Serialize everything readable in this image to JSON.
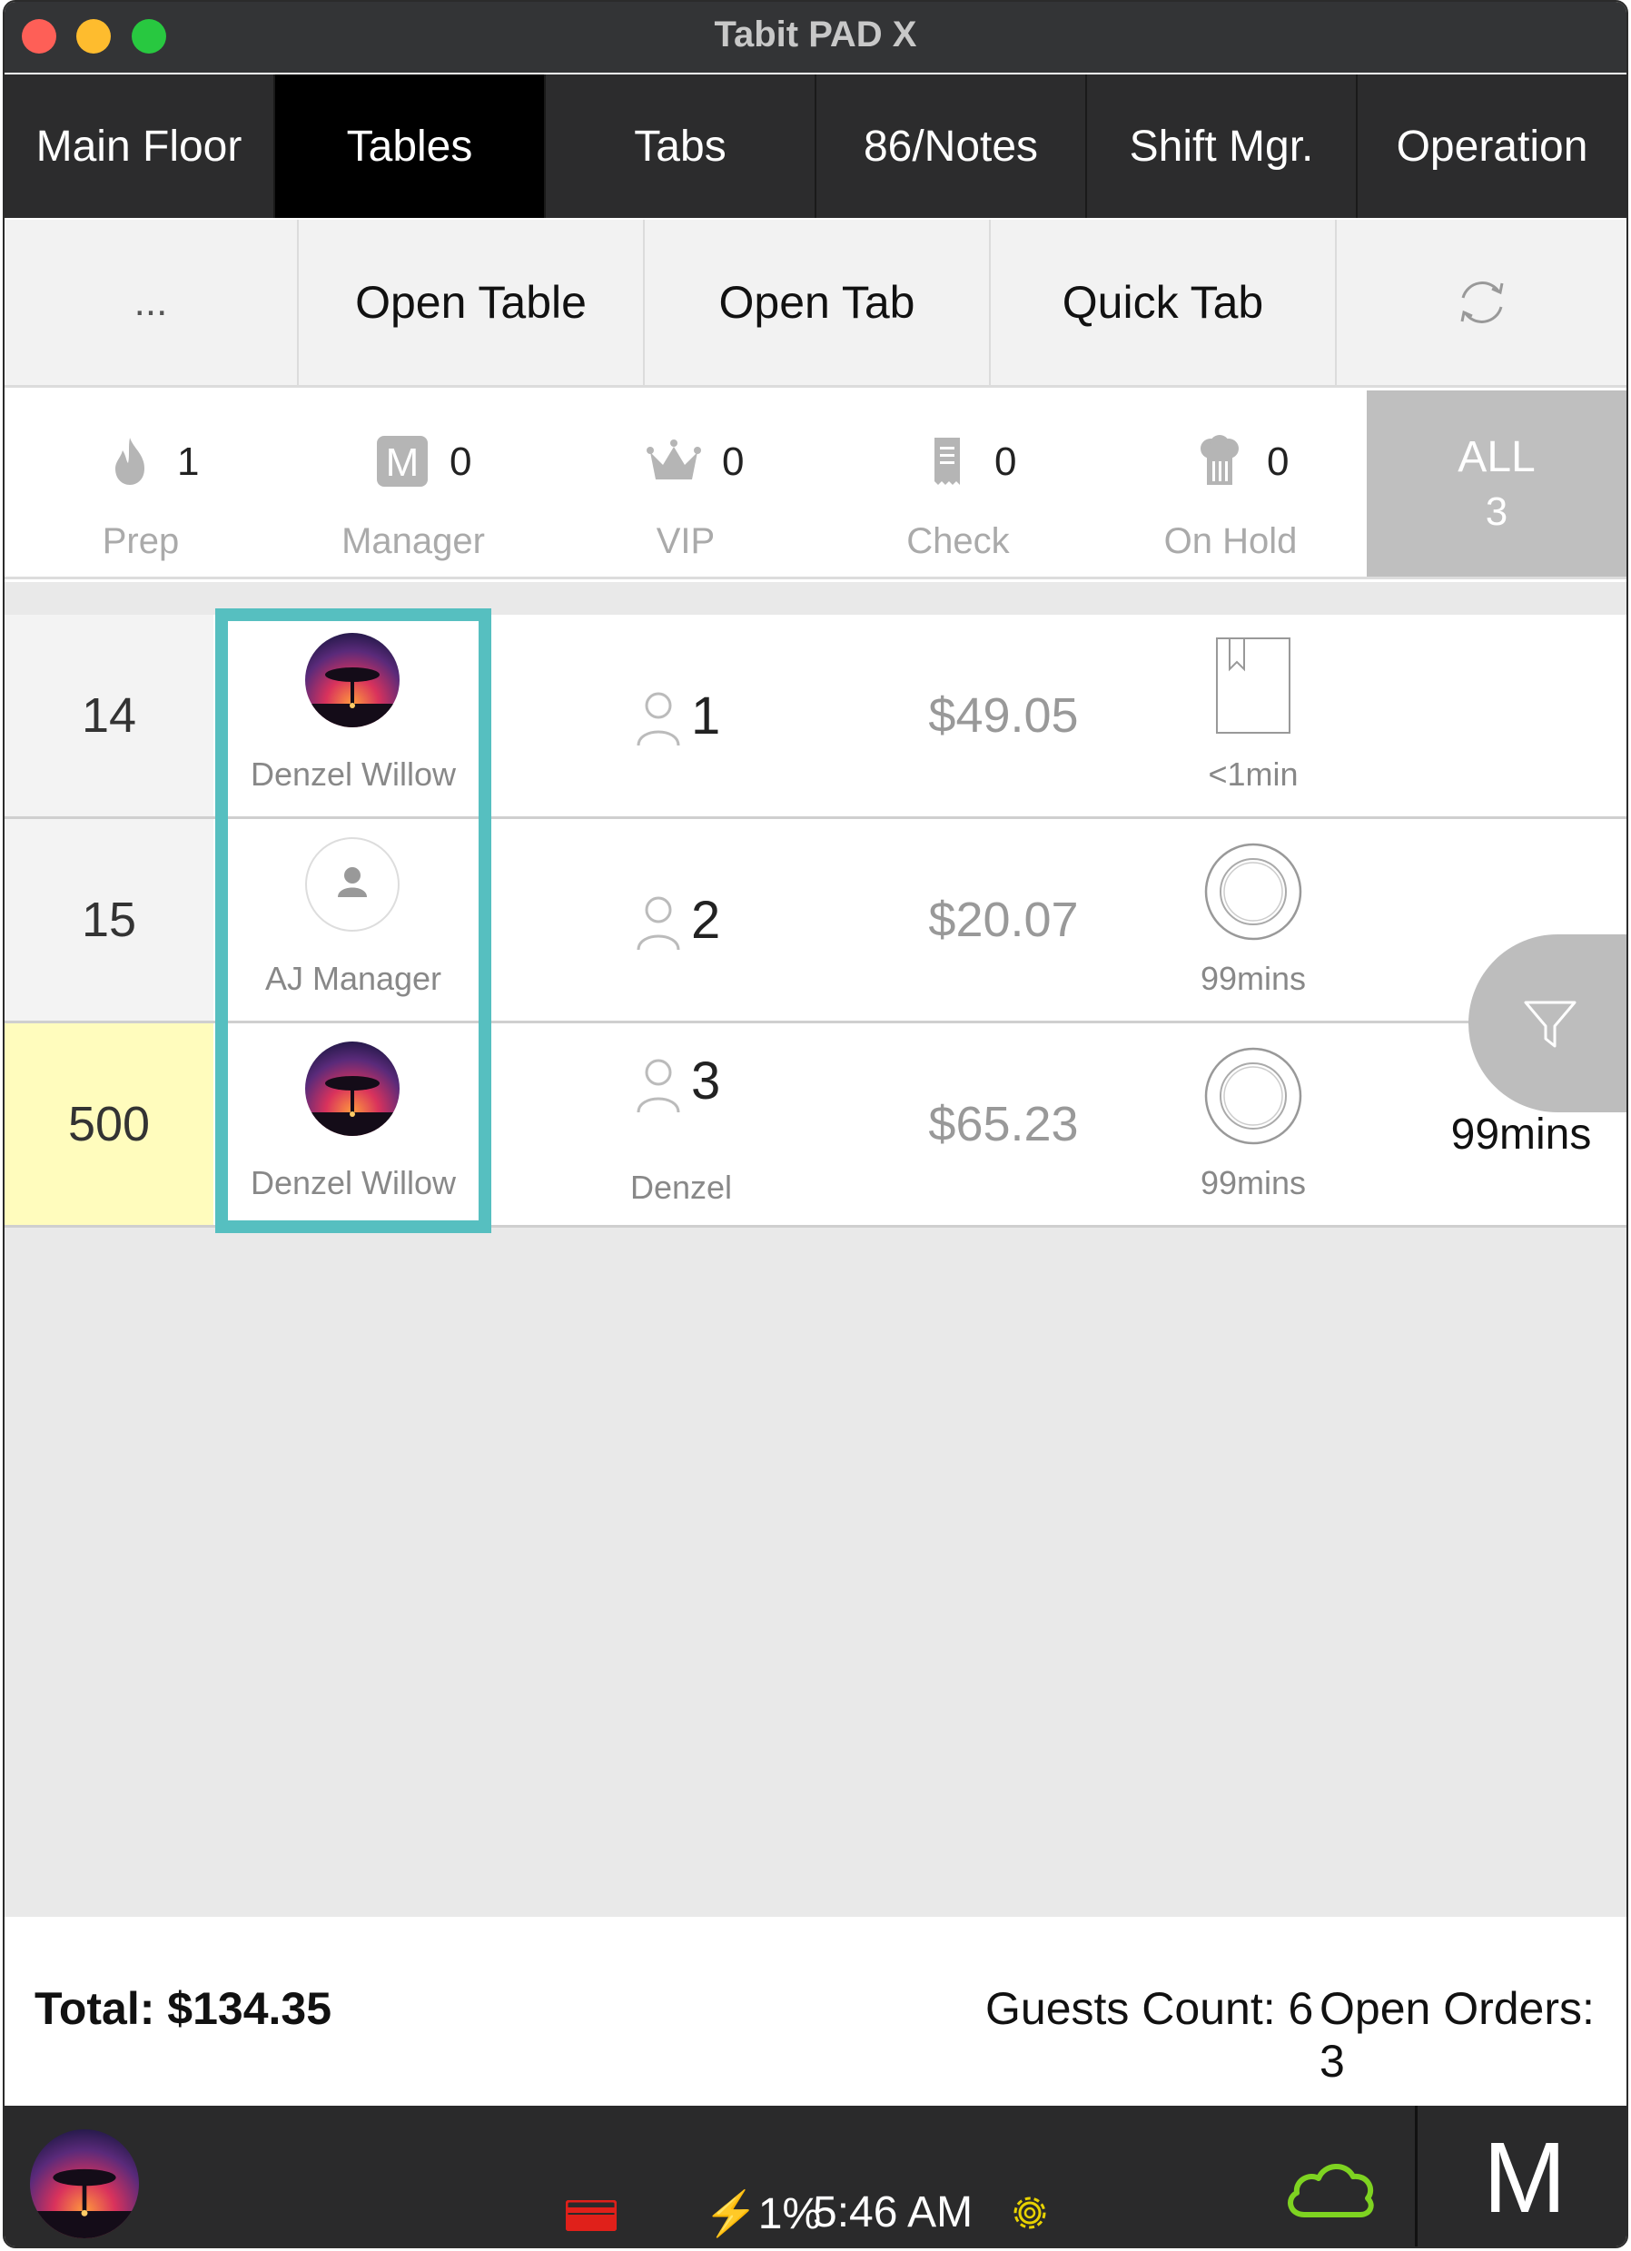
{
  "window": {
    "title": "Tabit PAD X"
  },
  "nav": {
    "tabs": [
      {
        "label": "Main Floor"
      },
      {
        "label": "Tables"
      },
      {
        "label": "Tabs"
      },
      {
        "label": "86/Notes"
      },
      {
        "label": "Shift Mgr."
      },
      {
        "label": "Operation"
      }
    ],
    "active": "Tables"
  },
  "actions": {
    "more": "...",
    "open_table": "Open Table",
    "open_tab": "Open Tab",
    "quick_tab": "Quick Tab",
    "refresh_icon": "refresh-icon"
  },
  "filters": {
    "items": [
      {
        "label": "Prep",
        "count": "1",
        "icon": "flame-icon"
      },
      {
        "label": "Manager",
        "count": "0",
        "icon": "manager-m-icon"
      },
      {
        "label": "VIP",
        "count": "0",
        "icon": "crown-icon"
      },
      {
        "label": "Check",
        "count": "0",
        "icon": "receipt-icon"
      },
      {
        "label": "On Hold",
        "count": "0",
        "icon": "chef-hat-icon"
      }
    ],
    "all": {
      "label": "ALL",
      "count": "3"
    }
  },
  "orders": [
    {
      "table": "14",
      "waiter": "Denzel Willow",
      "guests": "1",
      "amount": "$49.05",
      "status_icon": "bookmark-icon",
      "time": "<1min",
      "subtitle": "",
      "extra_time": ""
    },
    {
      "table": "15",
      "waiter": "AJ Manager",
      "guests": "2",
      "amount": "$20.07",
      "status_icon": "plate-icon",
      "time": "99mins",
      "subtitle": "",
      "extra_time": ""
    },
    {
      "table": "500",
      "waiter": "Denzel Willow",
      "guests": "3",
      "amount": "$65.23",
      "status_icon": "plate-icon",
      "time": "99mins",
      "subtitle": "Denzel",
      "extra_time": "99mins"
    }
  ],
  "totals": {
    "total": "Total: $134.35",
    "guests_count": "Guests Count: 6",
    "open_orders": "Open Orders: 3"
  },
  "status_bar": {
    "battery": "⚡1%",
    "time": "5:46 AM",
    "user_initial": "M"
  },
  "colors": {
    "highlight": "#56bfc0",
    "highlight_row": "#fffcbd",
    "cloud": "#7ed321",
    "gear": "#e8d200",
    "card": "#e0201a"
  }
}
